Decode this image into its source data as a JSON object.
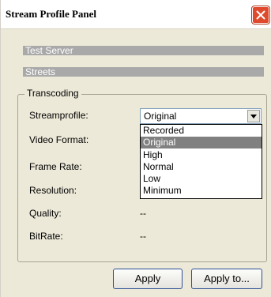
{
  "window": {
    "title": "Stream Profile Panel"
  },
  "servers": {
    "server_name": "Test Server",
    "camera_name": "Streets"
  },
  "transcoding": {
    "group_label": "Transcoding",
    "streamprofile_label": "Streamprofile:",
    "streamprofile_value": "Original",
    "video_format_label": "Video Format:",
    "frame_rate_label": "Frame Rate:",
    "resolution_label": "Resolution:",
    "quality_label": "Quality:",
    "quality_value": "--",
    "bitrate_label": "BitRate:",
    "bitrate_value": "--"
  },
  "dropdown": {
    "options": [
      "Recorded",
      "Original",
      "High",
      "Normal",
      "Low",
      "Minimum"
    ],
    "highlighted_index": 1
  },
  "buttons": {
    "apply": "Apply",
    "apply_to": "Apply to..."
  },
  "colors": {
    "close_button": "#e04a2c",
    "highlight": "#808080",
    "info_bar": "#a9a9a9"
  },
  "icons": {
    "close": "close-icon",
    "dropdown": "chevron-down-icon"
  }
}
